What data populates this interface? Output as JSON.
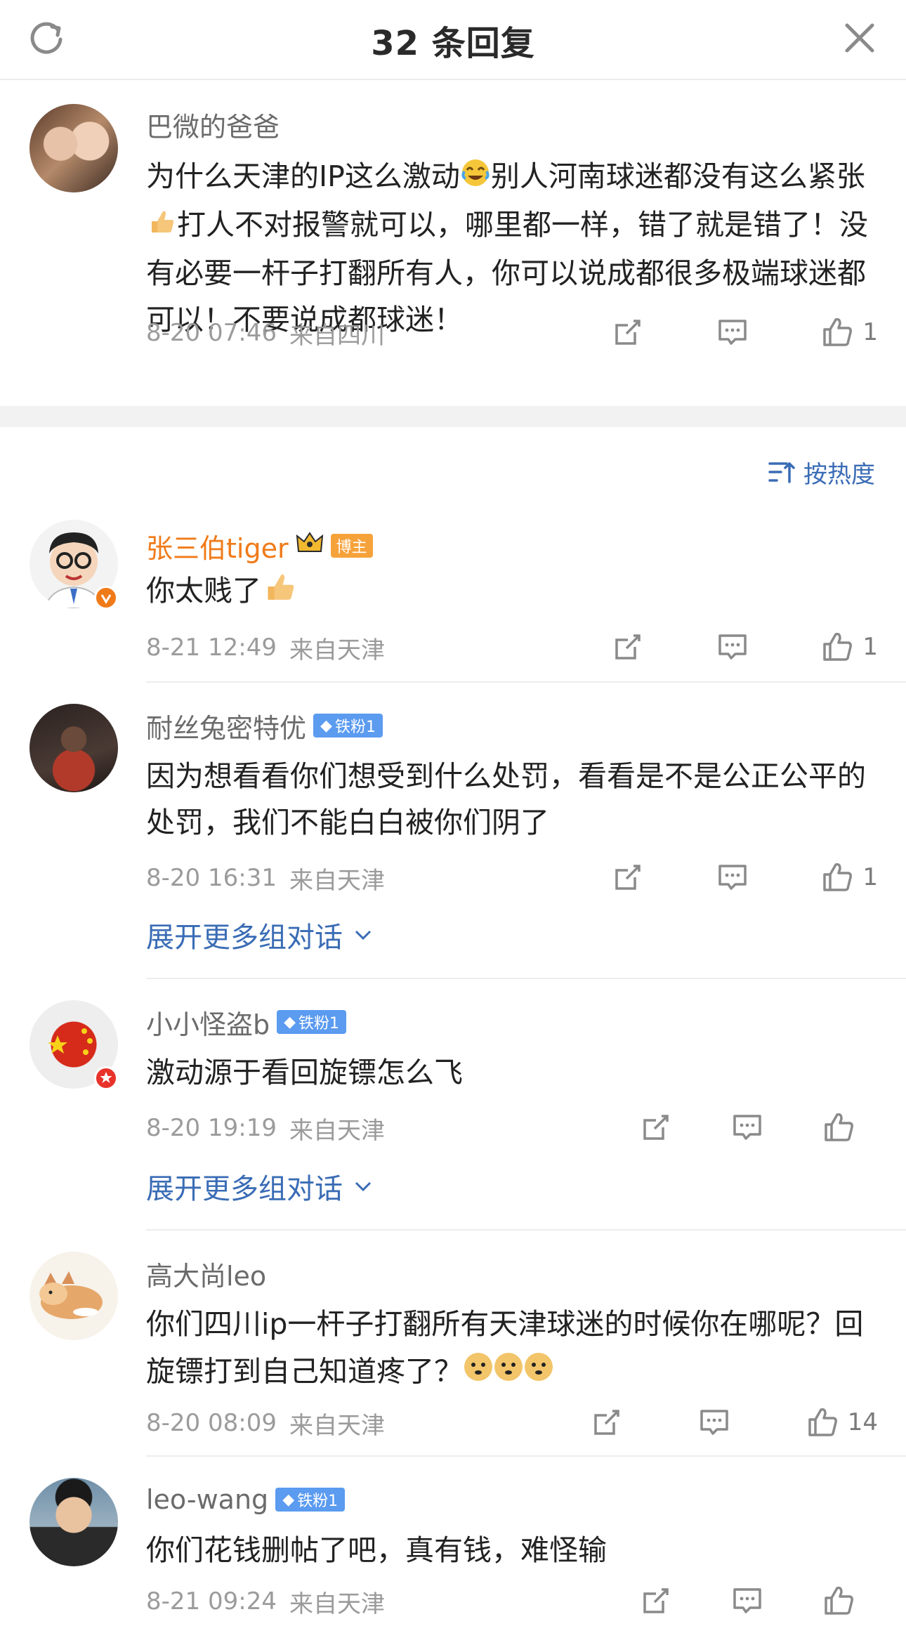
{
  "header": {
    "title": "32 条回复",
    "refresh_icon": "refresh-icon",
    "close_icon": "close-icon"
  },
  "main_comment": {
    "author": "巴微的爸爸",
    "text_parts": [
      "为什么天津的IP这么激动",
      "别人河南球迷都没有这么紧张",
      "打人不对报警就可以，哪里都一样，错了就是错了！没有必要一杆子打翻所有人，你可以说成都很多极端球迷都可以！不要说成都球迷！"
    ],
    "date": "8-20 07:46",
    "location": "来自四川",
    "likes": "1"
  },
  "sort": {
    "label": "按热度",
    "icon": "sort-icon"
  },
  "comments": [
    {
      "author": "张三伯tiger",
      "tag": "博主",
      "text": "你太贱了",
      "date": "8-21 12:49",
      "location": "来自天津",
      "likes": "1"
    },
    {
      "author": "耐丝兔密特优",
      "tag": "铁粉1",
      "text": "因为想看看你们想受到什么处罚，看看是不是公正公平的处罚，我们不能白白被你们阴了",
      "date": "8-20 16:31",
      "location": "来自天津",
      "likes": "1",
      "expand": "展开更多组对话"
    },
    {
      "author": "小小怪盗b",
      "tag": "铁粉1",
      "text": "激动源于看回旋镖怎么飞",
      "date": "8-20 19:19",
      "location": "来自天津",
      "likes": "",
      "expand": "展开更多组对话"
    },
    {
      "author": "高大尚leo",
      "tag": "",
      "text": "你们四川ip一杆子打翻所有天津球迷的时候你在哪呢？回旋镖打到自己知道疼了？",
      "date": "8-20 08:09",
      "location": "来自天津",
      "likes": "14"
    },
    {
      "author": "leo-wang",
      "tag": "铁粉1",
      "text": "你们花钱删帖了吧，真有钱，难怪输",
      "date": "8-21 09:24",
      "location": "来自天津",
      "likes": ""
    }
  ],
  "colors": {
    "link": "#3a6cb5",
    "host_name": "#f07a18",
    "iron_tag": "#5b9bf0",
    "host_tag": "#f6a23a"
  }
}
